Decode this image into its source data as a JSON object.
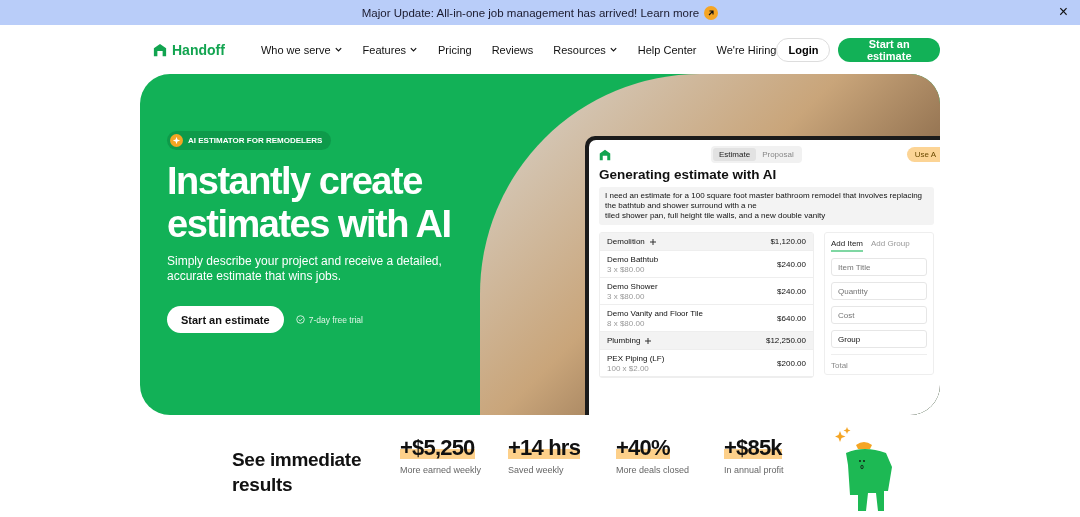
{
  "announcement": {
    "text": "Major Update: All-in-one job management has arrived! Learn more",
    "close": "×"
  },
  "nav": {
    "brand": "Handoff",
    "items": [
      {
        "label": "Who we serve",
        "has_menu": true
      },
      {
        "label": "Features",
        "has_menu": true
      },
      {
        "label": "Pricing",
        "has_menu": false
      },
      {
        "label": "Reviews",
        "has_menu": false
      },
      {
        "label": "Resources",
        "has_menu": true
      },
      {
        "label": "Help Center",
        "has_menu": false
      },
      {
        "label": "We're Hiring",
        "has_menu": false
      }
    ],
    "login": "Login",
    "cta": "Start an estimate"
  },
  "hero": {
    "badge": "AI ESTIMATOR FOR REMODELERS",
    "title": "Instantly create estimates with AI",
    "subtitle": "Simply describe your project and receive a detailed, accurate estimate that wins jobs.",
    "cta": "Start an estimate",
    "trial": "7-day free trial"
  },
  "app": {
    "tabs": [
      {
        "label": "Estimate",
        "selected": true
      },
      {
        "label": "Proposal",
        "selected": false
      }
    ],
    "ai_button": "Use A",
    "title": "Generating estimate with AI",
    "prompt": "I need an estimate for a 100 square foot master bathroom remodel that involves replacing the bathtub and shower surround with a ne\ntiled shower pan, full height tile walls, and a new double vanity",
    "rows": [
      {
        "kind": "group",
        "name": "Demolition",
        "amount": "$1,120.00"
      },
      {
        "kind": "item",
        "name": "Demo Bathtub",
        "detail": "3 x $80.00",
        "amount": "$240.00"
      },
      {
        "kind": "item",
        "name": "Demo Shower",
        "detail": "3 x $80.00",
        "amount": "$240.00"
      },
      {
        "kind": "item",
        "name": "Demo Vanity and Floor Tile",
        "detail": "8 x $80.00",
        "amount": "$640.00"
      },
      {
        "kind": "group",
        "name": "Plumbing",
        "amount": "$12,250.00"
      },
      {
        "kind": "item",
        "name": "PEX Piping (LF)",
        "detail": "100 x $2.00",
        "amount": "$200.00"
      }
    ],
    "panel_tabs": [
      {
        "label": "Add Item",
        "selected": true
      },
      {
        "label": "Add Group",
        "selected": false
      }
    ],
    "fields": [
      {
        "kind": "input",
        "placeholder": "Item Title"
      },
      {
        "kind": "input",
        "placeholder": "Quantity"
      },
      {
        "kind": "input",
        "placeholder": "Cost"
      },
      {
        "kind": "select",
        "value": "Group"
      },
      {
        "kind": "total",
        "label": "Total"
      }
    ]
  },
  "results": {
    "title": "See immediate results",
    "stats": [
      {
        "value": "+$5,250",
        "label": "More earned weekly"
      },
      {
        "value": "+14 hrs",
        "label": "Saved weekly"
      },
      {
        "value": "+40%",
        "label": "More deals closed"
      },
      {
        "value": "+$85k",
        "label": "In annual profit"
      }
    ]
  }
}
